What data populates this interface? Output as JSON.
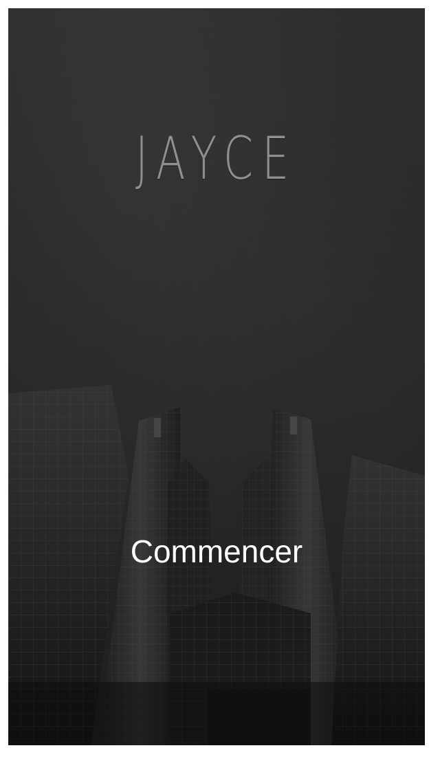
{
  "app": {
    "title": "JAYCE"
  },
  "actions": {
    "start_label": "Commencer"
  },
  "colors": {
    "background": "#2a2a2a",
    "logo": "#8f8f8f",
    "button_text": "#ffffff",
    "page": "#ffffff"
  }
}
